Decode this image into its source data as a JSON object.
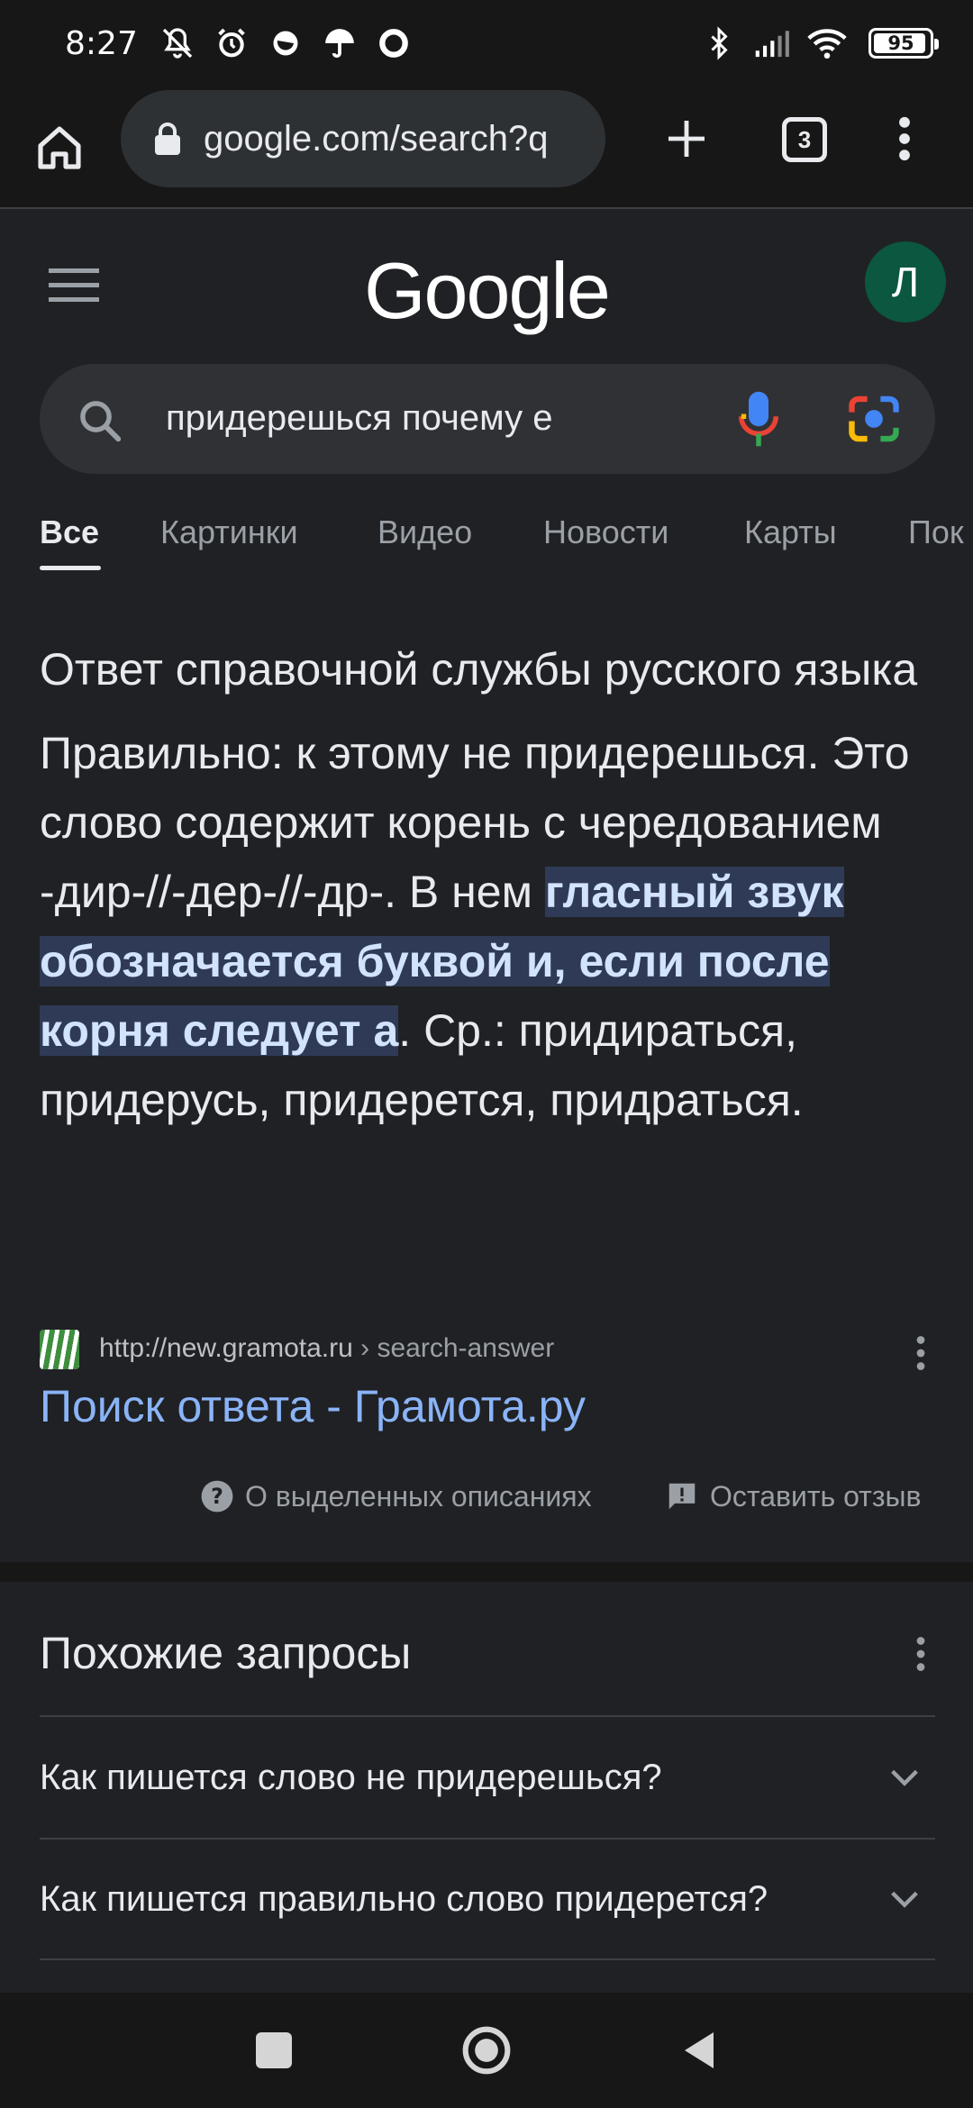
{
  "status_bar": {
    "time": "8:27",
    "battery": "95",
    "icons": [
      "muted-bell-icon",
      "alarm-icon",
      "weather-icon",
      "umbrella-icon",
      "circle-icon",
      "bluetooth-icon",
      "signal-icon",
      "wifi-icon",
      "battery-icon"
    ]
  },
  "browser": {
    "url": "google.com/search?q",
    "tab_count": "3"
  },
  "google": {
    "logo": "Google",
    "avatar_letter": "Л"
  },
  "search": {
    "query": "придерешься почему е"
  },
  "tabs": [
    {
      "label": "Все"
    },
    {
      "label": "Картинки"
    },
    {
      "label": "Видео"
    },
    {
      "label": "Новости"
    },
    {
      "label": "Карты"
    },
    {
      "label": "Пок"
    }
  ],
  "answer": {
    "title": "Ответ справочной службы русского языка",
    "text_before": "Правильно: к этому не придерешься. Это слово содержит корень с чередованием -дир-//-дер-//-др-. В нем ",
    "text_highlight": "гласный звук обозначается буквой и, если после корня следует а",
    "text_after": ". Ср.: придираться, придерусь, придерется, придраться."
  },
  "source": {
    "url": "http://new.gramota.ru",
    "breadcrumb": " › search-answer",
    "title": "Поиск ответа - Грамота.ру"
  },
  "feedback": {
    "about": "О выделенных описаниях",
    "feedback": "Оставить отзыв"
  },
  "related": {
    "title": "Похожие запросы",
    "items": [
      {
        "label": "Как пишется слово не придерешься?"
      },
      {
        "label": "Как пишется правильно слово придерется?"
      }
    ]
  },
  "colors": {
    "background": "#202124",
    "link": "#8ab4f8",
    "highlight_bg": "#2f3b56",
    "avatar_bg": "#0b5740"
  }
}
